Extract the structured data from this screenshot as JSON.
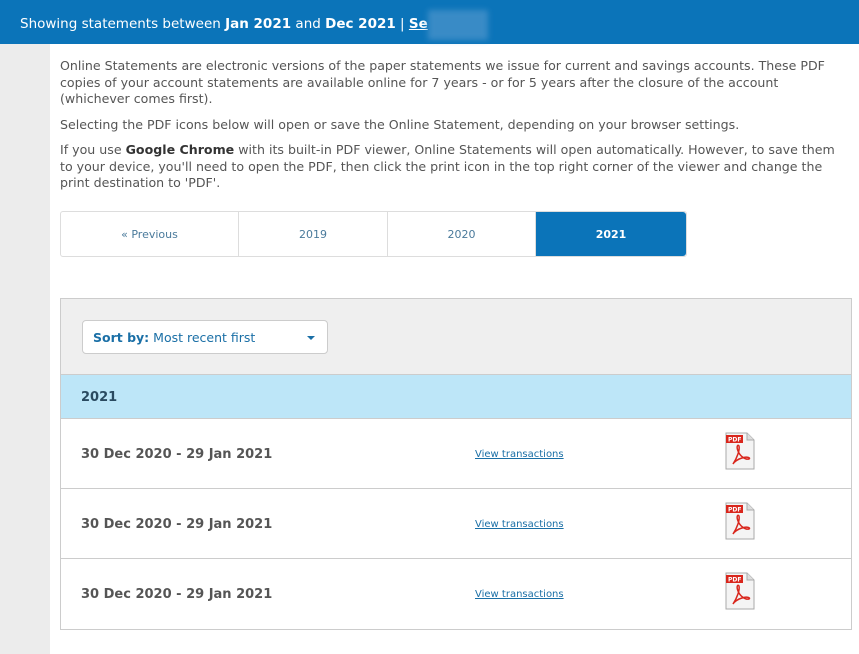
{
  "header": {
    "prefix": "Showing statements between ",
    "from": "Jan 2021",
    "mid": " and ",
    "to": "Dec 2021",
    "sep": " | ",
    "link": "Se"
  },
  "intro": {
    "p1": "Online Statements are electronic versions of the paper statements we issue for current and savings accounts. These PDF copies of your account statements are available online for 7 years - or for 5 years after the closure of the account (whichever comes first).",
    "p2": "Selecting the PDF icons below will open or save the Online Statement, depending on your browser settings.",
    "p3a": "If you use ",
    "p3b": "Google Chrome",
    "p3c": " with its built-in PDF viewer, Online Statements will open automatically. However, to save them to your device, you'll need to open the PDF, then click the print icon in the top right corner of the viewer and change the print destination to 'PDF'."
  },
  "tabs": [
    {
      "label": "« Previous"
    },
    {
      "label": "2019"
    },
    {
      "label": "2020"
    },
    {
      "label": "2021",
      "active": true
    }
  ],
  "sort": {
    "label": "Sort by:",
    "value": "Most recent first"
  },
  "year": "2021",
  "statements": [
    {
      "period": "30 Dec 2020 - 29 Jan 2021",
      "link": "View transactions",
      "icon": "pdf-icon"
    },
    {
      "period": "30 Dec 2020 - 29 Jan 2021",
      "link": "View transactions",
      "icon": "pdf-icon"
    },
    {
      "period": "30 Dec 2020 - 29 Jan 2021",
      "link": "View transactions",
      "icon": "pdf-icon"
    }
  ],
  "colors": {
    "brand": "#0b74b9",
    "year_bg": "#bde6f8",
    "pdf_red": "#d9261c"
  }
}
